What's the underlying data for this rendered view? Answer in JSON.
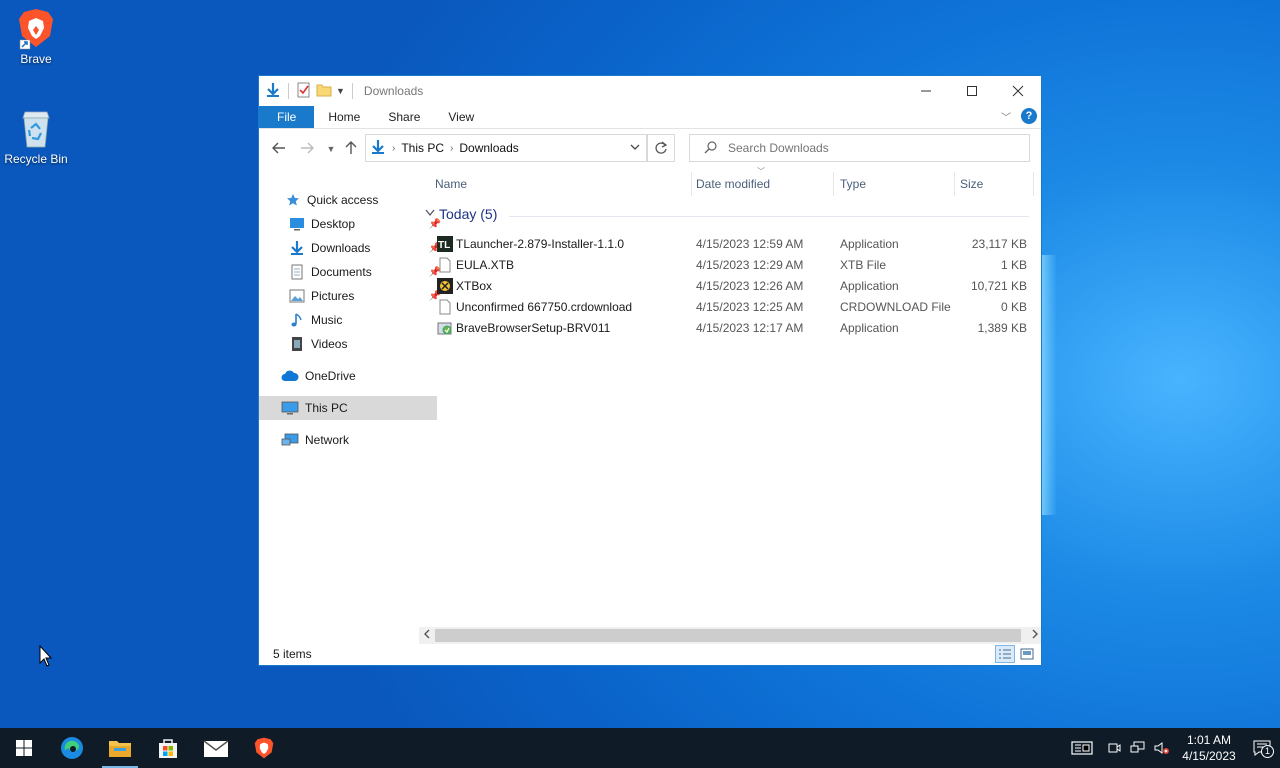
{
  "desktop": {
    "icons": [
      {
        "label": "Brave"
      },
      {
        "label": "Recycle Bin"
      }
    ]
  },
  "window": {
    "title": "Downloads",
    "ribbon_tabs": [
      "File",
      "Home",
      "Share",
      "View"
    ],
    "help_glyph": "?",
    "address": {
      "segments": [
        "This PC",
        "Downloads"
      ]
    },
    "search_placeholder": "Search Downloads",
    "sidebar": {
      "items": [
        {
          "label": "Quick access",
          "icon": "star-icon"
        },
        {
          "label": "Desktop",
          "icon": "desktop-icon",
          "pinned": true
        },
        {
          "label": "Downloads",
          "icon": "download-icon",
          "pinned": true
        },
        {
          "label": "Documents",
          "icon": "documents-icon",
          "pinned": true
        },
        {
          "label": "Pictures",
          "icon": "pictures-icon",
          "pinned": true
        },
        {
          "label": "Music",
          "icon": "music-icon"
        },
        {
          "label": "Videos",
          "icon": "videos-icon"
        },
        {
          "label": "OneDrive",
          "icon": "cloud-icon"
        },
        {
          "label": "This PC",
          "icon": "computer-icon",
          "selected": true
        },
        {
          "label": "Network",
          "icon": "network-icon"
        }
      ]
    },
    "columns": {
      "name": "Name",
      "date": "Date modified",
      "type": "Type",
      "size": "Size"
    },
    "group_label": "Today (5)",
    "files": [
      {
        "name": "TLauncher-2.879-Installer-1.1.0",
        "date": "4/15/2023 12:59 AM",
        "type": "Application",
        "size": "23,117 KB"
      },
      {
        "name": "EULA.XTB",
        "date": "4/15/2023 12:29 AM",
        "type": "XTB File",
        "size": "1 KB"
      },
      {
        "name": "XTBox",
        "date": "4/15/2023 12:26 AM",
        "type": "Application",
        "size": "10,721 KB"
      },
      {
        "name": "Unconfirmed 667750.crdownload",
        "date": "4/15/2023 12:25 AM",
        "type": "CRDOWNLOAD File",
        "size": "0 KB"
      },
      {
        "name": "BraveBrowserSetup-BRV011",
        "date": "4/15/2023 12:17 AM",
        "type": "Application",
        "size": "1,389 KB"
      }
    ],
    "status_text": "5 items"
  },
  "taskbar": {
    "time": "1:01 AM",
    "date": "4/15/2023",
    "notification_count": "1"
  },
  "colors": {
    "accent": "#1979ca",
    "taskbar": "#0f1b26"
  }
}
